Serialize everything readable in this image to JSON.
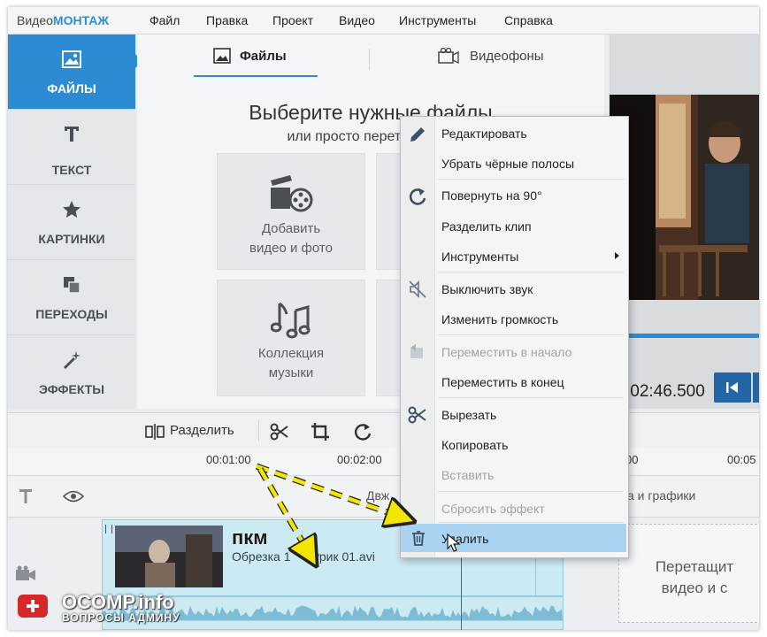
{
  "app": {
    "logo_part1": "Видео",
    "logo_part2": "МОНТАЖ",
    "menu": [
      "Файл",
      "Правка",
      "Проект",
      "Видео",
      "Инструменты",
      "Справка"
    ]
  },
  "sidebar": {
    "items": [
      {
        "label": "ФАЙЛЫ",
        "icon": "image-icon",
        "active": true
      },
      {
        "label": "ТЕКСТ",
        "icon": "text-icon",
        "active": false
      },
      {
        "label": "КАРТИНКИ",
        "icon": "star-icon",
        "active": false
      },
      {
        "label": "ПЕРЕХОДЫ",
        "icon": "transition-icon",
        "active": false
      },
      {
        "label": "ЭФФЕКТЫ",
        "icon": "magic-wand-icon",
        "active": false
      }
    ]
  },
  "files_panel": {
    "tabs": [
      {
        "label": "Файлы",
        "icon": "image-icon",
        "active": true
      },
      {
        "label": "Видеофоны",
        "icon": "film-icon",
        "active": false
      }
    ],
    "title": "Выберите нужные файлы",
    "subtitle": "или просто перетащите и",
    "tiles": [
      {
        "line1": "Добавить",
        "line2": "видео и фото",
        "icon": "film-reel-icon"
      },
      {
        "line1": "Коллекция",
        "line2": "музыки",
        "icon": "music-notes-icon"
      }
    ]
  },
  "preview": {
    "timecode": ":02:46.500"
  },
  "toolbar": {
    "split_label": "Разделить"
  },
  "ruler": {
    "labels": [
      "00:01:00",
      "00:02:00",
      "00",
      "00:05"
    ]
  },
  "timeline": {
    "text_track_hint": "Двж",
    "text_track_hint2": "а и графики",
    "clip_label": "Обрезка 1",
    "clip_label2": "урик 01.avi",
    "drop_line1": "Перетащит",
    "drop_line2": "видео и с"
  },
  "context_menu": {
    "items": [
      {
        "label": "Редактировать",
        "icon": "pencil-icon",
        "disabled": false
      },
      {
        "label": "Убрать чёрные полосы",
        "disabled": false
      },
      {
        "label": "Повернуть на 90°",
        "icon": "rotate-icon",
        "disabled": false
      },
      {
        "label": "Разделить клип",
        "disabled": false
      },
      {
        "label": "Инструменты",
        "disabled": false,
        "submenu": true
      },
      {
        "label": "Выключить звук",
        "icon": "mute-icon",
        "disabled": false
      },
      {
        "label": "Изменить громкость",
        "disabled": false
      },
      {
        "label": "Переместить в начало",
        "icon": "move-icon",
        "disabled": true
      },
      {
        "label": "Переместить в конец",
        "disabled": false
      },
      {
        "label": "Вырезать",
        "icon": "scissors-icon",
        "disabled": false
      },
      {
        "label": "Копировать",
        "disabled": false
      },
      {
        "label": "Вставить",
        "disabled": true
      },
      {
        "label": "Сбросить эффект",
        "disabled": true
      },
      {
        "label": "Удалить",
        "icon": "trash-icon",
        "disabled": false,
        "highlighted": true
      }
    ]
  },
  "annotation": {
    "pkm_label": "пкм"
  },
  "watermark": {
    "title": "OCOMP.info",
    "subtitle": "ВОПРОСЫ АДМИНУ"
  },
  "colors": {
    "accent": "#2d8bd3",
    "menu_highlight": "#a9d3f0",
    "annotation_arrow": "#f2e600"
  }
}
